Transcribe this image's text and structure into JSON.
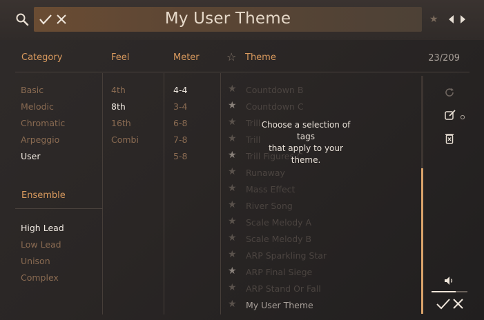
{
  "header": {
    "title": "My User Theme",
    "icons": {
      "search": "search-icon",
      "confirm": "checkmark-icon",
      "clear": "close-icon",
      "favorite": "star-icon",
      "prev": "arrow-left-icon",
      "next": "arrow-right-icon"
    }
  },
  "columns": {
    "category": "Category",
    "feel": "Feel",
    "meter": "Meter",
    "theme": "Theme",
    "count": "23/209"
  },
  "category": {
    "items": [
      "Basic",
      "Melodic",
      "Chromatic",
      "Arpeggio",
      "User"
    ],
    "selected": "User"
  },
  "ensemble": {
    "label": "Ensemble",
    "items": [
      "High Lead",
      "Low Lead",
      "Unison",
      "Complex"
    ],
    "selected": "High Lead"
  },
  "feel": {
    "items": [
      "4th",
      "8th",
      "16th",
      "Combi"
    ],
    "selected": "8th"
  },
  "meter": {
    "items": [
      "4-4",
      "3-4",
      "6-8",
      "7-8",
      "5-8"
    ],
    "selected": "4-4"
  },
  "themes": [
    {
      "name": "Countdown B",
      "starred": false
    },
    {
      "name": "Countdown C",
      "starred": true
    },
    {
      "name": "Trill",
      "starred": false
    },
    {
      "name": "Trill",
      "starred": false
    },
    {
      "name": "Trill Figures C",
      "starred": true
    },
    {
      "name": "Runaway",
      "starred": false
    },
    {
      "name": "Mass Effect",
      "starred": false
    },
    {
      "name": "River Song",
      "starred": false
    },
    {
      "name": "Scale Melody A",
      "starred": false
    },
    {
      "name": "Scale Melody B",
      "starred": false
    },
    {
      "name": "ARP Sparkling Star",
      "starred": false
    },
    {
      "name": "ARP Final Siege",
      "starred": true
    },
    {
      "name": "ARP Stand Or Fall",
      "starred": false
    },
    {
      "name": "My User Theme",
      "starred": false
    }
  ],
  "hint": {
    "line1": "Choose a selection of tags",
    "line2": "that apply to your theme."
  },
  "actions": {
    "icons": [
      "reset-icon",
      "edit-icon",
      "delete-icon",
      "volume-icon"
    ],
    "volume_level": 0.67
  },
  "colors": {
    "accent": "#d99a5e",
    "selected_text": "#f0e9e1",
    "dim_text": "#8a6b52"
  }
}
